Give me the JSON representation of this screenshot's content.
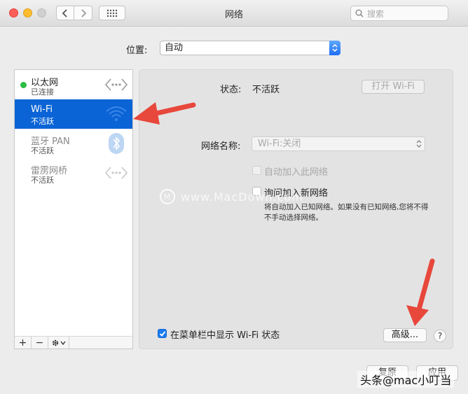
{
  "window": {
    "title": "网络",
    "search_placeholder": "搜索"
  },
  "location": {
    "label": "位置:",
    "value": "自动"
  },
  "services": [
    {
      "name": "以太网",
      "status": "已连接",
      "state": "connected",
      "icon": "ethernet-icon"
    },
    {
      "name": "Wi-Fi",
      "status": "不活跃",
      "state": "selected",
      "icon": "wifi-icon"
    },
    {
      "name": "蓝牙 PAN",
      "status": "不活跃",
      "state": "inactive",
      "icon": "bluetooth-icon"
    },
    {
      "name": "雷雳网桥",
      "status": "不活跃",
      "state": "inactive",
      "icon": "thunderbolt-bridge-icon"
    }
  ],
  "list_toolbar": {
    "add": "+",
    "remove": "−"
  },
  "detail": {
    "status_label": "状态:",
    "status_value": "不活跃",
    "turn_on_wifi_button": "打开 Wi-Fi",
    "network_name_label": "网络名称:",
    "network_name_value": "Wi-Fi:关闭",
    "auto_join_label": "自动加入此网络",
    "ask_join_label": "询问加入新网络",
    "ask_join_help": "将自动加入已知网络。如果没有已知网络,您将不得不手动选择网络。",
    "show_menubar_label": "在菜单栏中显示 Wi-Fi 状态",
    "show_menubar_checked": true,
    "advanced_button": "高级...",
    "help_button": "?"
  },
  "footer": {
    "revert_button": "复原",
    "apply_button": "应用"
  },
  "overlay": {
    "watermark": "www.MacDown.com",
    "footer_text": "头条@mac小叮当"
  },
  "colors": {
    "selection": "#0a64d6",
    "connected_dot": "#2bbd44",
    "annotation_arrow": "#e8473c"
  }
}
